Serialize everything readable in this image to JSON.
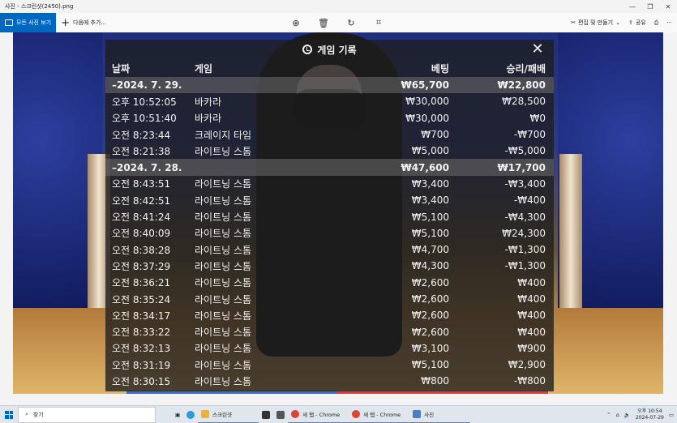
{
  "window": {
    "title": "사진 - 스크린샷(2450).png",
    "controls": [
      "—",
      "❐",
      "✕"
    ]
  },
  "toolbar": {
    "all_photos": "모든 사진 보기",
    "add_to": "다음에 추가...",
    "edit_create": "편집 및 만들기",
    "share": "공유"
  },
  "panel": {
    "title": "게임 기록",
    "headers": {
      "date": "날짜",
      "game": "게임",
      "bet": "베팅",
      "winloss": "승리/패배"
    },
    "rows": [
      {
        "type": "day",
        "date": "–2024. 7. 29.",
        "game": "",
        "bet": "₩65,700",
        "win": "₩22,800"
      },
      {
        "type": "item",
        "date": "오후 10:52:05",
        "game": "바카라",
        "bet": "₩30,000",
        "win": "₩28,500"
      },
      {
        "type": "item",
        "date": "오후 10:51:40",
        "game": "바카라",
        "bet": "₩30,000",
        "win": "₩0"
      },
      {
        "type": "item",
        "date": "오전 8:23:44",
        "game": "크레이지 타임",
        "bet": "₩700",
        "win": "-₩700"
      },
      {
        "type": "item",
        "date": "오전 8:21:38",
        "game": "라이트닝 스톰",
        "bet": "₩5,000",
        "win": "-₩5,000"
      },
      {
        "type": "day",
        "date": "–2024. 7. 28.",
        "game": "",
        "bet": "₩47,600",
        "win": "₩17,700"
      },
      {
        "type": "item",
        "date": "오전 8:43:51",
        "game": "라이트닝 스톰",
        "bet": "₩3,400",
        "win": "-₩3,400"
      },
      {
        "type": "item",
        "date": "오전 8:42:51",
        "game": "라이트닝 스톰",
        "bet": "₩3,400",
        "win": "-₩400"
      },
      {
        "type": "item",
        "date": "오전 8:41:24",
        "game": "라이트닝 스톰",
        "bet": "₩5,100",
        "win": "-₩4,300"
      },
      {
        "type": "item",
        "date": "오전 8:40:09",
        "game": "라이트닝 스톰",
        "bet": "₩5,100",
        "win": "₩24,300"
      },
      {
        "type": "item",
        "date": "오전 8:38:28",
        "game": "라이트닝 스톰",
        "bet": "₩4,700",
        "win": "-₩1,300"
      },
      {
        "type": "item",
        "date": "오전 8:37:29",
        "game": "라이트닝 스톰",
        "bet": "₩4,300",
        "win": "-₩1,300"
      },
      {
        "type": "item",
        "date": "오전 8:36:21",
        "game": "라이트닝 스톰",
        "bet": "₩2,600",
        "win": "₩400"
      },
      {
        "type": "item",
        "date": "오전 8:35:24",
        "game": "라이트닝 스톰",
        "bet": "₩2,600",
        "win": "₩400"
      },
      {
        "type": "item",
        "date": "오전 8:34:17",
        "game": "라이트닝 스톰",
        "bet": "₩2,600",
        "win": "₩400"
      },
      {
        "type": "item",
        "date": "오전 8:33:22",
        "game": "라이트닝 스톰",
        "bet": "₩2,600",
        "win": "₩400"
      },
      {
        "type": "item",
        "date": "오전 8:32:13",
        "game": "라이트닝 스톰",
        "bet": "₩3,100",
        "win": "₩900"
      },
      {
        "type": "item",
        "date": "오전 8:31:19",
        "game": "라이트닝 스톰",
        "bet": "₩5,100",
        "win": "₩2,900"
      },
      {
        "type": "item",
        "date": "오전 8:30:15",
        "game": "라이트닝 스톰",
        "bet": "₩800",
        "win": "-₩800"
      }
    ]
  },
  "taskbar": {
    "search": "찾기",
    "tasks": [
      {
        "label": "스크린샷",
        "icon": "folder-icon"
      },
      {
        "label": "새 탭 - Chrome",
        "icon": "chrome-icon"
      },
      {
        "label": "새 탭 - Chrome",
        "icon": "chrome-icon"
      },
      {
        "label": "사진",
        "icon": "photos-icon"
      }
    ],
    "time": "오후 10:54",
    "date": "2024-07-29"
  }
}
